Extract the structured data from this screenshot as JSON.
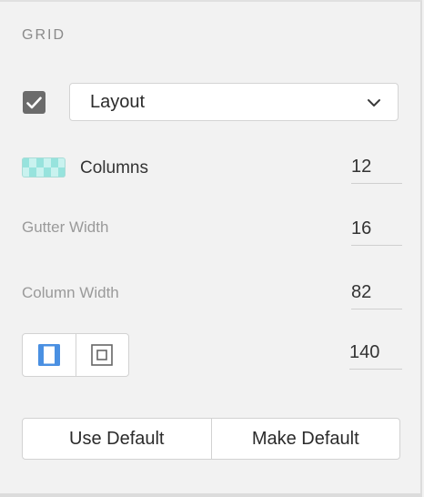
{
  "section": {
    "title": "GRID"
  },
  "layout": {
    "enabled": true,
    "selected": "Layout"
  },
  "rows": {
    "columns": {
      "label": "Columns",
      "value": "12"
    },
    "gutter": {
      "label": "Gutter Width",
      "value": "16"
    },
    "column_width": {
      "label": "Column Width",
      "value": "82"
    },
    "offset": {
      "value": "140"
    }
  },
  "buttons": {
    "use_default": "Use Default",
    "make_default": "Make Default"
  },
  "colors": {
    "accent": "#4a90e2",
    "columns_icon_light": "#c9f2ef",
    "columns_icon_dark": "#97e3dd",
    "checkbox": "#6b6b6b"
  },
  "icons": {
    "checkbox": "checkmark-icon",
    "dropdown": "chevron-down-icon",
    "columns": "columns-grid-icon",
    "seg_left": "stretch-columns-icon",
    "seg_right": "centered-box-icon"
  }
}
